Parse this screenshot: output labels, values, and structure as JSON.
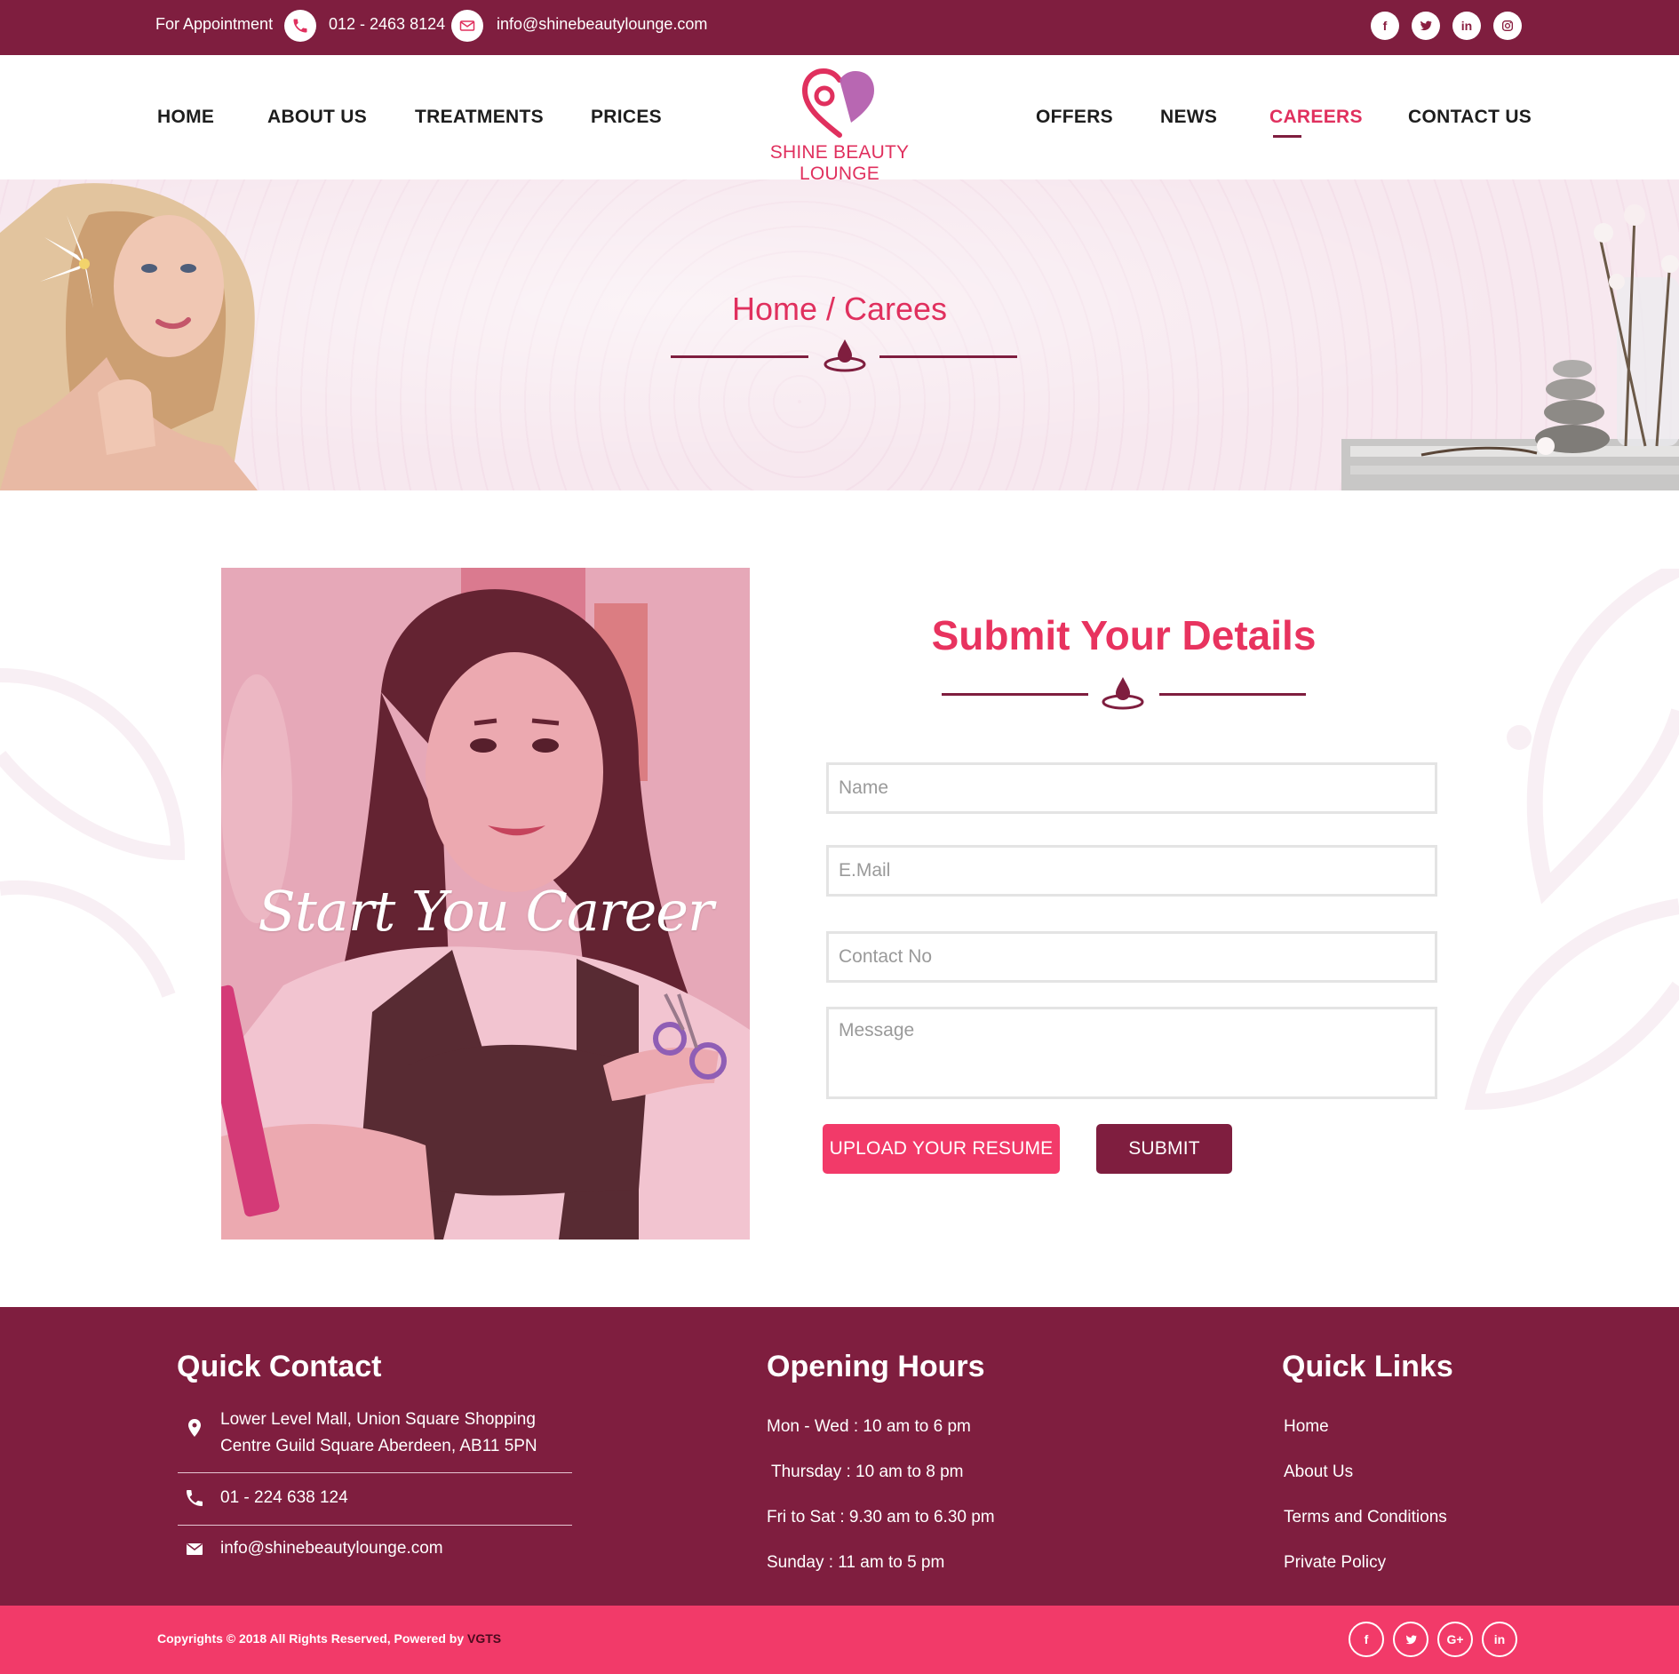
{
  "colors": {
    "brand_dark": "#7f1e3f",
    "brand_pink": "#e0305e",
    "accent_button": "#f23a69",
    "banner_bg": "#f7e8ef"
  },
  "topbar": {
    "appointment_label": "For Appointment",
    "phone": "012 - 2463 8124",
    "email": "info@shinebeautylounge.com",
    "social": [
      "f",
      "t",
      "in",
      "ig"
    ]
  },
  "nav": {
    "left_items": [
      "HOME",
      "ABOUT US",
      "TREATMENTS",
      "PRICES"
    ],
    "right_items": [
      "OFFERS",
      "NEWS",
      "CAREERS",
      "CONTACT US"
    ],
    "active": "CAREERS"
  },
  "logo": {
    "text": "SHINE BEAUTY LOUNGE"
  },
  "banner": {
    "breadcrumb": "Home / Carees"
  },
  "career": {
    "tagline": "Start You Career"
  },
  "form": {
    "title": "Submit Your Details",
    "name_placeholder": "Name",
    "email_placeholder": "E.Mail",
    "contact_placeholder": "Contact No",
    "message_placeholder": "Message",
    "upload_label": "UPLOAD YOUR RESUME",
    "submit_label": "SUBMIT"
  },
  "footer": {
    "quick_contact": {
      "title": "Quick Contact",
      "address_line1": "Lower Level Mall, Union Square Shopping",
      "address_line2": "Centre Guild Square Aberdeen, AB11 5PN",
      "phone": "01 - 224 638 124",
      "email": "info@shinebeautylounge.com"
    },
    "opening_hours": {
      "title": "Opening Hours",
      "items": [
        "Mon - Wed : 10 am to 6 pm",
        "Thursday : 10 am  to 8 pm",
        "Fri to Sat : 9.30 am  to 6.30 pm",
        "Sunday : 11 am to 5 pm"
      ]
    },
    "quick_links": {
      "title": "Quick Links",
      "items": [
        "Home",
        "About Us",
        "Terms and Conditions",
        "Private Policy"
      ]
    }
  },
  "bottom": {
    "copyright": "Copyrights © 2018 All Rights Reserved, Powered by",
    "powered_by": "VGTS",
    "social": [
      "f",
      "t",
      "G+",
      "in"
    ]
  }
}
